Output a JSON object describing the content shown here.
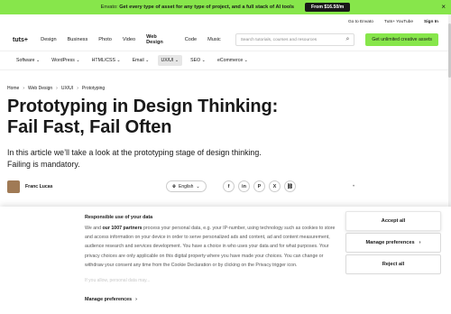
{
  "promo": {
    "text_prefix": "Envato: ",
    "text_bold": "Get every type of asset for any type of project, and a full stack of AI tools",
    "button": "From $16.50/m",
    "close": "×"
  },
  "util": {
    "links": [
      "Go to Envato",
      "Tuts+ YouTube",
      "Sign In"
    ]
  },
  "nav": {
    "logo": "tuts+",
    "items": [
      "Design",
      "Business",
      "Photo",
      "Video",
      "Web Design",
      "Code",
      "Music"
    ],
    "active": "Web Design",
    "search_placeholder": "Search tutorials, courses and resources",
    "cta": "Get unlimited creative assets"
  },
  "subnav": {
    "items": [
      {
        "label": "Software",
        "chevron": true
      },
      {
        "label": "WordPress",
        "chevron": true
      },
      {
        "label": "HTML/CSS",
        "chevron": true
      },
      {
        "label": "Email",
        "chevron": true
      },
      {
        "label": "UX/UI",
        "chevron": true,
        "active": true
      },
      {
        "label": "SEO",
        "chevron": true
      },
      {
        "label": "eCommerce",
        "chevron": true
      }
    ]
  },
  "breadcrumb": [
    "Home",
    "Web Design",
    "UX/UI",
    "Prototyping"
  ],
  "article": {
    "title_line1": "Prototyping in Design Thinking:",
    "title_line2": "Fail Fast, Fail Often",
    "subtitle_line1": "In this article we’ll take a look at the prototyping stage of design thinking.",
    "subtitle_line2": "Failing is mandatory.",
    "author": "Franc Lucas",
    "language": "English",
    "share_icons": [
      "facebook-icon",
      "linkedin-icon",
      "pinterest-icon",
      "x-icon",
      "link-icon"
    ]
  },
  "consent": {
    "title": "Responsible use of your data",
    "body_start": "We and ",
    "body_bold": "our 1007 partners",
    "body_rest": " process your personal data, e.g. your IP-number, using technology such as cookies to store and access information on your device in order to serve personalized ads and content, ad and content measurement, audience research and services development. You have a choice in who uses your data and for what purposes. Your privacy choices are only applicable on this digital property where you have made your choices. You can change or withdraw your consent any time from the Cookie Declaration or by clicking on the Privacy trigger icon.",
    "faded": "If you allow, personal data may...",
    "manage_link": "Manage preferences",
    "accept": "Accept all",
    "manage": "Manage preferences",
    "reject": "Reject all"
  },
  "colors": {
    "brand_green": "#87e64b",
    "text": "#191919"
  }
}
